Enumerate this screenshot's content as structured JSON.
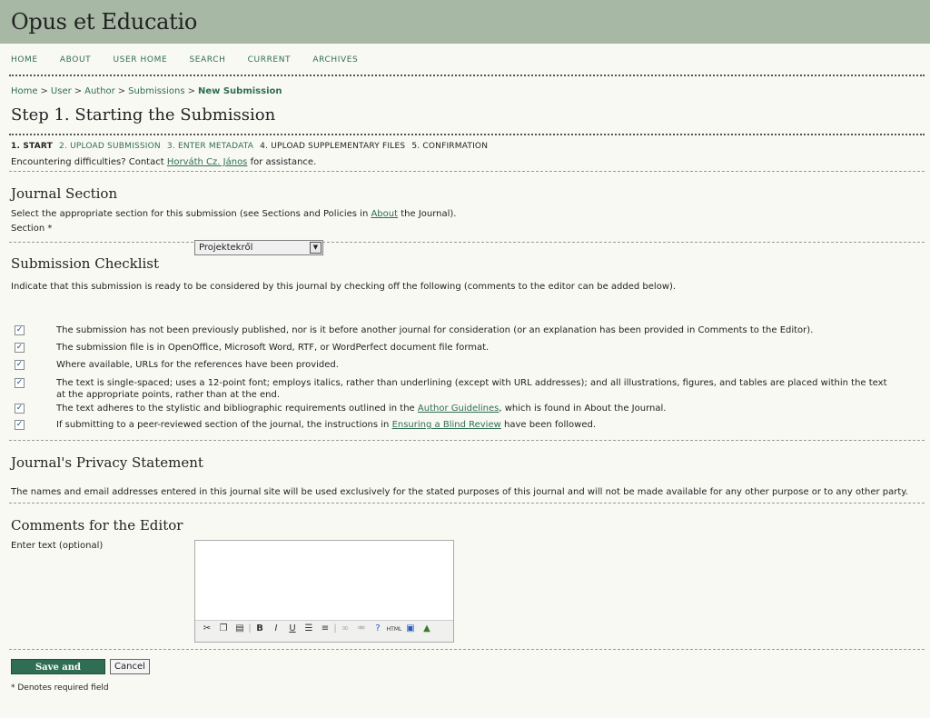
{
  "header": {
    "title": "Opus et Educatio"
  },
  "nav": [
    "HOME",
    "ABOUT",
    "USER HOME",
    "SEARCH",
    "CURRENT",
    "ARCHIVES"
  ],
  "breadcrumb": {
    "home": "Home",
    "user": "User",
    "author": "Author",
    "submissions": "Submissions",
    "current": "New Submission",
    "sep": ">"
  },
  "page_title": "Step 1. Starting the Submission",
  "steps": [
    "1. START",
    "2. UPLOAD SUBMISSION",
    "3. ENTER METADATA",
    "4. UPLOAD SUPPLEMENTARY FILES",
    "5. CONFIRMATION"
  ],
  "assistance": {
    "before": "Encountering difficulties? Contact ",
    "contact": "Horváth Cz. János",
    "after": " for assistance."
  },
  "journal_section": {
    "heading": "Journal Section",
    "desc_before": "Select the appropriate section for this submission (see Sections and Policies in ",
    "desc_link": "About",
    "desc_after": " the Journal).",
    "label": "Section *",
    "selected": "Projektekről"
  },
  "checklist": {
    "heading": "Submission Checklist",
    "intro": "Indicate that this submission is ready to be considered by this journal by checking off the following (comments to the editor can be added below).",
    "items": [
      {
        "text": "The submission has not been previously published, nor is it before another journal for consideration (or an explanation has been provided in Comments to the Editor).",
        "checked": true
      },
      {
        "text": "The submission file is in OpenOffice, Microsoft Word, RTF, or WordPerfect document file format.",
        "checked": true
      },
      {
        "text": "Where available, URLs for the references have been provided.",
        "checked": true
      },
      {
        "text": "The text is single-spaced; uses a 12-point font; employs italics, rather than underlining (except with URL addresses); and all illustrations, figures, and tables are placed within the text at the appropriate points, rather than at the end.",
        "checked": true
      },
      {
        "text_before": "The text adheres to the stylistic and bibliographic requirements outlined in the ",
        "link": "Author Guidelines",
        "text_after": ", which is found in About the Journal.",
        "checked": true
      },
      {
        "text_before": "If submitting to a peer-reviewed section of the journal, the instructions in ",
        "link": "Ensuring a Blind Review",
        "text_after": " have been followed.",
        "checked": true
      }
    ],
    "check_glyph": "✓"
  },
  "privacy": {
    "heading": "Journal's Privacy Statement",
    "text": "The names and email addresses entered in this journal site will be used exclusively for the stated purposes of this journal and will not be made available for any other purpose or to any other party."
  },
  "comments": {
    "heading": "Comments for the Editor",
    "label": "Enter text (optional)"
  },
  "editor_toolbar": [
    "cut-icon",
    "copy-icon",
    "paste-icon",
    "bold-icon",
    "italic-icon",
    "underline-icon",
    "bullet-list-icon",
    "numbered-list-icon",
    "link-icon",
    "unlink-icon",
    "help-icon",
    "html-icon",
    "fullscreen-icon",
    "image-icon"
  ],
  "buttons": {
    "save": "Save and continue",
    "cancel": "Cancel"
  },
  "footnote": "* Denotes required field"
}
